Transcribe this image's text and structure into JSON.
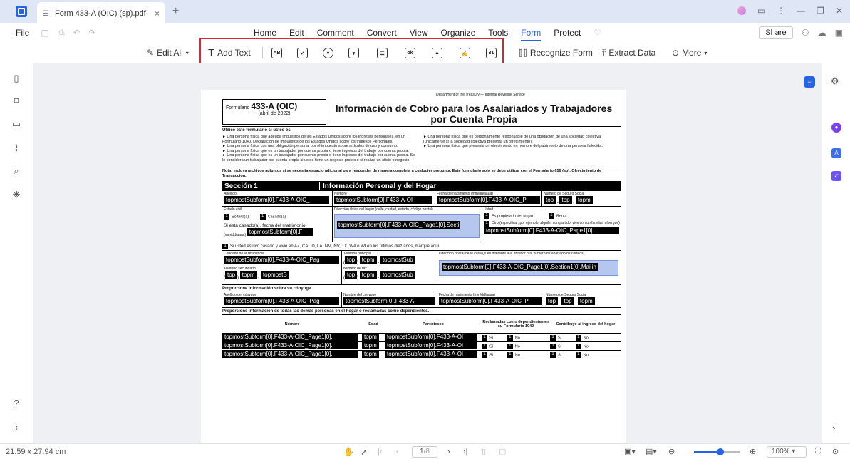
{
  "tab": {
    "title": "Form 433-A (OIC) (sp).pdf"
  },
  "menu": {
    "file": "File",
    "items": [
      "Home",
      "Edit",
      "Comment",
      "Convert",
      "View",
      "Organize",
      "Tools",
      "Form",
      "Protect"
    ],
    "active": "Form",
    "share": "Share"
  },
  "toolbar": {
    "edit_all": "Edit All",
    "add_text": "Add Text",
    "recognize_form": "Recognize Form",
    "extract_data": "Extract Data",
    "more": "More",
    "icons": [
      "text-field-icon",
      "checkbox-icon",
      "radio-button-icon",
      "combo-box-icon",
      "list-box-icon",
      "button-icon",
      "image-field-icon",
      "signature-field-icon",
      "date-field-icon"
    ]
  },
  "doc": {
    "dept": "Department of the Treasury — Internal Revenue Service",
    "form_label": "Formulario",
    "form_number": "433-A (OIC)",
    "form_date": "(abril de 2022)",
    "title_line1": "Información de Cobro para los Asalariados y Trabajadores",
    "title_line2": "por Cuenta Propia",
    "use_heading": "Utilice este formulario si usted es",
    "left_bullets": [
      "Una persona física que adeuda impuestos de los Estados Unidos sobre los ingresos personales, en un Formulario 1040, Declaración de Impuestos de los Estados Unidos sobre los Ingresos Personales.",
      "Una persona física con una obligación personal por el impuesto sobre artículos de uso y consumo.",
      "Una persona física que es un trabajador por cuenta propia o tiene ingresos del trabajo por cuenta propia.",
      "Una persona física que es un trabajador por cuenta propia o tiene ingresos del trabajo por cuenta propia. Se le considera un trabajador por cuenta propia si usted tiene un negocio propio o si realiza un oficio o negocio."
    ],
    "right_bullets": [
      "Una persona física que es personalmente responsable de una obligación de una sociedad colectiva (únicamente si la sociedad colectiva presenta un ofrecimiento).",
      "Una persona física que presenta un ofrecimiento en nombre del patrimonio de una persona fallecida."
    ],
    "note": "Nota: Incluya archivos adjuntos si se necesita espacio adicional para responder de manera completa a cualquier pregunta. Este formulario solo se debe utilizar con el Formulario 656 (sp), Ofrecimiento de Transacción.",
    "section_label": "Sección 1",
    "section_title": "Información Personal y del Hogar",
    "apellido": "Apellido",
    "nombre": "Nombre",
    "fecha_nac": "Fecha de nacimiento (mm/dd/aaaa)",
    "ssn": "Número de Seguro Social",
    "estado_civil": "Estado civil",
    "soltero": "Soltero(a)",
    "casado": "Casado(a)",
    "direccion": "Dirección física del hogar (calle, ciudad, estado, código postal)",
    "usted": "Usted",
    "propietario": "Es propietario del hogar",
    "renta": "Renta",
    "si_casado": "Si está casado(a), fecha del matrimonio",
    "mmdd": "(mm/dd/aaaa)",
    "otro": "Otro (especificar; por ejemplo, alquiler compartido, vive con un familiar, albergue)",
    "az_line": "Si usted estuvo casado y vivió en AZ, CA, ID, LA, NM, NV, TX, WA o WI en los últimos diez años, marque aquí.",
    "condado": "Condado de la residencia",
    "tel_principal": "Teléfono principal",
    "dir_postal": "Dirección postal de la casa (si es diferente a la anterior o al número de apartado de correos)",
    "tel_secundario": "Teléfono secundario",
    "fax": "Número de fax",
    "conyuge_heading": "Proporcione información sobre su cónyuge.",
    "apellido_conyuge": "Apellido del cónyuge",
    "nombre_conyuge": "Nombre del cónyuge",
    "hogar_heading": "Proporcione información de todas las demás personas en el hogar o reclamadas como dependientes.",
    "col_nombre": "Nombre",
    "col_edad": "Edad",
    "col_parentesco": "Parentesco",
    "col_reclamadas": "Reclamadas como dependientes en su Formulario 1040",
    "col_contribuye": "Contribuye al ingreso del hogar",
    "si": "Sí",
    "no": "No",
    "f_apellido": "topmostSubform[0].F433-A-OIC_",
    "f_nombre": "topmostSubform[0].F433-A-OI",
    "f_fecha": "topmostSubform[0].F433-A-OIC_P",
    "f_ssn1": "top",
    "f_ssn2": "top",
    "f_ssn3": "topm",
    "f_matrimonio": "topmostSubform[0].F",
    "f_direccion": "topmostSubform[0].F433-A-OIC_Page1[0].Secti",
    "f_otro": "topmostSubform[0].F433-A-OIC_Page1[0].",
    "f_condado": "topmostSubform[0].F433-A-OIC_Pag",
    "f_tel_a": "top",
    "f_tel_b": "topm",
    "f_tel_c": "topmostSub",
    "f_postal": "topmostSubform[0].F433-A-OIC_Page1[0].Section1[0].Mailin",
    "f_tel2_c": "topmostS",
    "f_conyuge_ap": "topmostSubform[0].F433-A-OIC_Pag",
    "f_conyuge_nom": "topmostSubform[0].F433-A-",
    "f_row_nombre": "topmostSubform[0].F433-A-OIC_Page1[0].",
    "f_row_edad": "topm",
    "f_row_par": "topmostSubform[0].F433-A-OI"
  },
  "status": {
    "size": "21.59 x 27.94 cm",
    "page": "1",
    "page_total": "/8",
    "zoom": "100%",
    "zoom_level": 0.58
  }
}
